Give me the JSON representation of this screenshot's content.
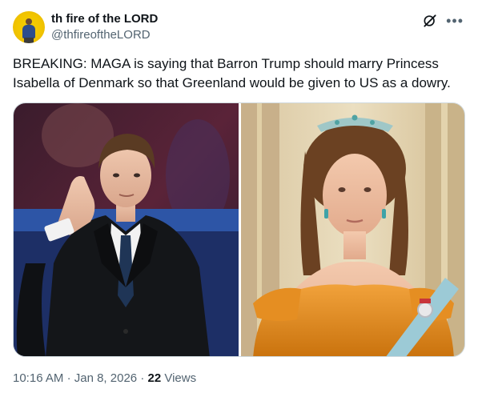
{
  "author": {
    "display_name": "th fire of the LORD",
    "handle": "@thfireoftheLORD",
    "avatar_icon": "avatar-person-on-yellow"
  },
  "header_icons": [
    "grok-icon",
    "more-options-icon"
  ],
  "tweet": {
    "text": "BREAKING: MAGA is saying that Barron Trump should marry Princess Isabella of Denmark so that Greenland would be given to US as a dowry."
  },
  "media": {
    "left_photo": "young man in dark suit holding hand to ear",
    "right_photo": "young woman in orange gown with tiara and blue sash"
  },
  "meta": {
    "time": "10:16 AM",
    "separator": "·",
    "date": "Jan 8, 2026",
    "views_count": "22",
    "views_label": "Views"
  },
  "colors": {
    "text_primary": "#0f1419",
    "text_secondary": "#536471",
    "border": "#cfd9de",
    "avatar_bg": "#f2c500"
  }
}
